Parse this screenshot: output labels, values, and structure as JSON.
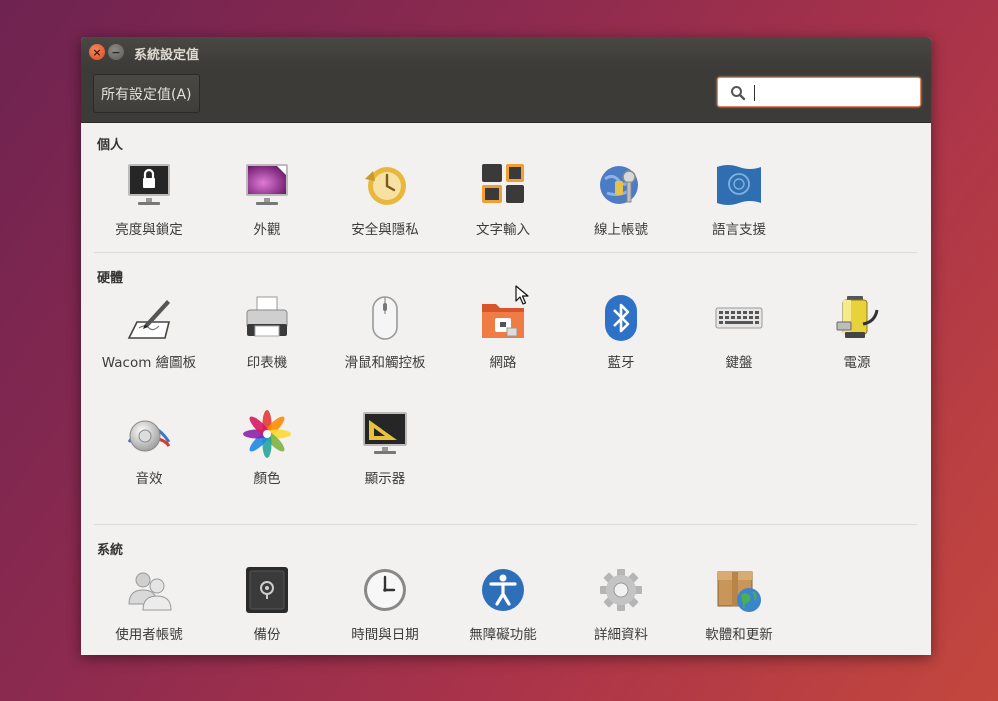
{
  "window": {
    "title": "系統設定值"
  },
  "toolbar": {
    "all_settings_label": "所有設定值(A)",
    "search_value": "",
    "search_placeholder": ""
  },
  "sections": [
    {
      "title": "個人",
      "items": [
        {
          "label": "亮度與鎖定",
          "icon": "brightness-lock-icon"
        },
        {
          "label": "外觀",
          "icon": "appearance-icon"
        },
        {
          "label": "安全與隱私",
          "icon": "security-privacy-icon"
        },
        {
          "label": "文字輸入",
          "icon": "text-entry-icon"
        },
        {
          "label": "線上帳號",
          "icon": "online-accounts-icon"
        },
        {
          "label": "語言支援",
          "icon": "language-support-icon"
        }
      ]
    },
    {
      "title": "硬體",
      "items": [
        {
          "label": "Wacom 繪圖板",
          "icon": "wacom-tablet-icon"
        },
        {
          "label": "印表機",
          "icon": "printer-icon"
        },
        {
          "label": "滑鼠和觸控板",
          "icon": "mouse-icon"
        },
        {
          "label": "網路",
          "icon": "network-icon"
        },
        {
          "label": "藍牙",
          "icon": "bluetooth-icon"
        },
        {
          "label": "鍵盤",
          "icon": "keyboard-icon"
        },
        {
          "label": "電源",
          "icon": "power-icon"
        },
        {
          "label": "音效",
          "icon": "sound-icon"
        },
        {
          "label": "顏色",
          "icon": "color-icon"
        },
        {
          "label": "顯示器",
          "icon": "displays-icon"
        }
      ]
    },
    {
      "title": "系統",
      "items": [
        {
          "label": "使用者帳號",
          "icon": "user-accounts-icon"
        },
        {
          "label": "備份",
          "icon": "backup-icon"
        },
        {
          "label": "時間與日期",
          "icon": "time-date-icon"
        },
        {
          "label": "無障礙功能",
          "icon": "accessibility-icon"
        },
        {
          "label": "詳細資料",
          "icon": "details-icon"
        },
        {
          "label": "軟體和更新",
          "icon": "software-updates-icon"
        }
      ]
    }
  ],
  "colors": {
    "titlebar": "#3c3b37",
    "close_button": "#df4a16",
    "window_bg": "#f2f1f0",
    "search_focus": "#e08560"
  }
}
